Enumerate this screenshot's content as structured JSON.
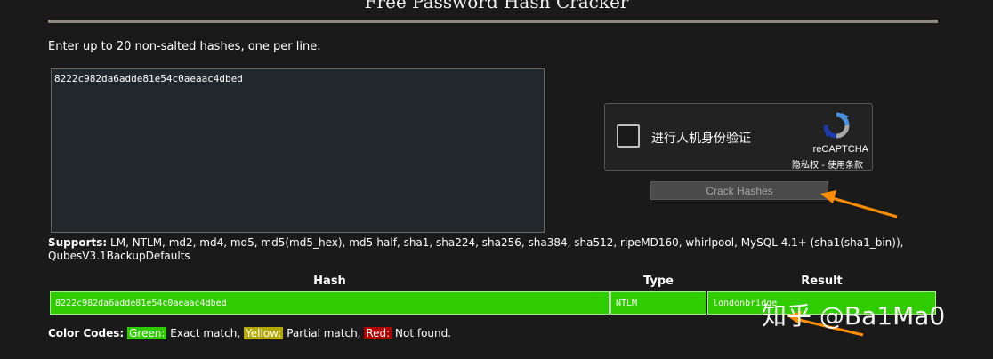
{
  "page": {
    "title": "Free Password Hash Cracker",
    "instructions": "Enter up to 20 non-salted hashes, one per line:"
  },
  "hash_input": {
    "value": "8222c982da6adde81e54c0aeaac4dbed"
  },
  "recaptcha": {
    "label": "进行人机身份验证",
    "brand": "reCAPTCHA",
    "links": "隐私权 - 使用条款"
  },
  "crack_button": {
    "label": "Crack Hashes"
  },
  "supports": {
    "label": "Supports:",
    "text": "LM, NTLM, md2, md4, md5, md5(md5_hex), md5-half, sha1, sha224, sha256, sha384, sha512, ripeMD160, whirlpool, MySQL 4.1+ (sha1(sha1_bin)), QubesV3.1BackupDefaults"
  },
  "results": {
    "columns": [
      "Hash",
      "Type",
      "Result"
    ],
    "rows": [
      {
        "hash": "8222c982da6adde81e54c0aeaac4dbed",
        "type": "NTLM",
        "result": "londonbridge"
      }
    ]
  },
  "color_codes": {
    "label": "Color Codes:",
    "green": "Green:",
    "green_desc": "Exact match,",
    "yellow": "Yellow:",
    "yellow_desc": "Partial match,",
    "red": "Red:",
    "red_desc": "Not found."
  },
  "watermark": {
    "text": "知乎 @Ba1Ma0"
  },
  "colors": {
    "background": "#1a1a1a",
    "exact_match": "#2fcc00",
    "partial_match": "#b3a800",
    "not_found": "#b30000",
    "annotation_arrow": "#ff8c00"
  },
  "icons": [
    "recaptcha-logo-icon",
    "checkbox-icon",
    "annotation-arrow-icon"
  ]
}
